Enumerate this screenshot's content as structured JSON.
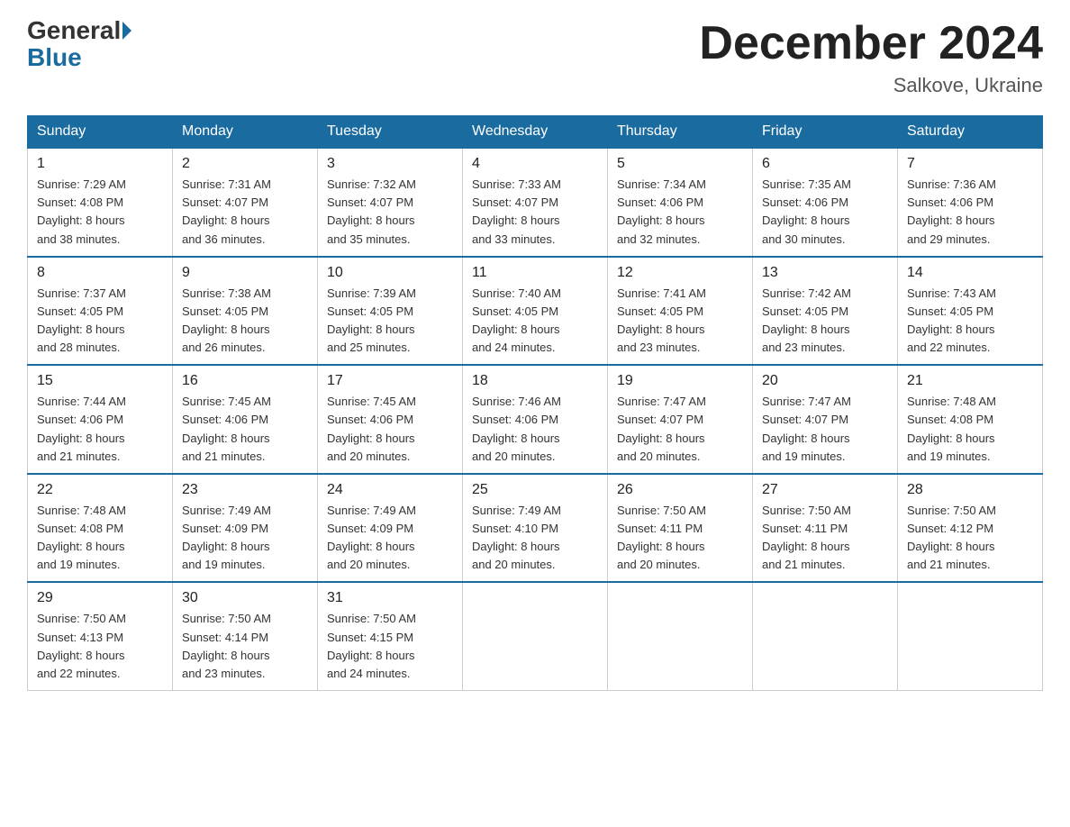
{
  "logo": {
    "general": "General",
    "blue": "Blue"
  },
  "title": "December 2024",
  "subtitle": "Salkove, Ukraine",
  "days_header": [
    "Sunday",
    "Monday",
    "Tuesday",
    "Wednesday",
    "Thursday",
    "Friday",
    "Saturday"
  ],
  "weeks": [
    [
      {
        "num": "1",
        "sunrise": "7:29 AM",
        "sunset": "4:08 PM",
        "daylight": "8 hours and 38 minutes."
      },
      {
        "num": "2",
        "sunrise": "7:31 AM",
        "sunset": "4:07 PM",
        "daylight": "8 hours and 36 minutes."
      },
      {
        "num": "3",
        "sunrise": "7:32 AM",
        "sunset": "4:07 PM",
        "daylight": "8 hours and 35 minutes."
      },
      {
        "num": "4",
        "sunrise": "7:33 AM",
        "sunset": "4:07 PM",
        "daylight": "8 hours and 33 minutes."
      },
      {
        "num": "5",
        "sunrise": "7:34 AM",
        "sunset": "4:06 PM",
        "daylight": "8 hours and 32 minutes."
      },
      {
        "num": "6",
        "sunrise": "7:35 AM",
        "sunset": "4:06 PM",
        "daylight": "8 hours and 30 minutes."
      },
      {
        "num": "7",
        "sunrise": "7:36 AM",
        "sunset": "4:06 PM",
        "daylight": "8 hours and 29 minutes."
      }
    ],
    [
      {
        "num": "8",
        "sunrise": "7:37 AM",
        "sunset": "4:05 PM",
        "daylight": "8 hours and 28 minutes."
      },
      {
        "num": "9",
        "sunrise": "7:38 AM",
        "sunset": "4:05 PM",
        "daylight": "8 hours and 26 minutes."
      },
      {
        "num": "10",
        "sunrise": "7:39 AM",
        "sunset": "4:05 PM",
        "daylight": "8 hours and 25 minutes."
      },
      {
        "num": "11",
        "sunrise": "7:40 AM",
        "sunset": "4:05 PM",
        "daylight": "8 hours and 24 minutes."
      },
      {
        "num": "12",
        "sunrise": "7:41 AM",
        "sunset": "4:05 PM",
        "daylight": "8 hours and 23 minutes."
      },
      {
        "num": "13",
        "sunrise": "7:42 AM",
        "sunset": "4:05 PM",
        "daylight": "8 hours and 23 minutes."
      },
      {
        "num": "14",
        "sunrise": "7:43 AM",
        "sunset": "4:05 PM",
        "daylight": "8 hours and 22 minutes."
      }
    ],
    [
      {
        "num": "15",
        "sunrise": "7:44 AM",
        "sunset": "4:06 PM",
        "daylight": "8 hours and 21 minutes."
      },
      {
        "num": "16",
        "sunrise": "7:45 AM",
        "sunset": "4:06 PM",
        "daylight": "8 hours and 21 minutes."
      },
      {
        "num": "17",
        "sunrise": "7:45 AM",
        "sunset": "4:06 PM",
        "daylight": "8 hours and 20 minutes."
      },
      {
        "num": "18",
        "sunrise": "7:46 AM",
        "sunset": "4:06 PM",
        "daylight": "8 hours and 20 minutes."
      },
      {
        "num": "19",
        "sunrise": "7:47 AM",
        "sunset": "4:07 PM",
        "daylight": "8 hours and 20 minutes."
      },
      {
        "num": "20",
        "sunrise": "7:47 AM",
        "sunset": "4:07 PM",
        "daylight": "8 hours and 19 minutes."
      },
      {
        "num": "21",
        "sunrise": "7:48 AM",
        "sunset": "4:08 PM",
        "daylight": "8 hours and 19 minutes."
      }
    ],
    [
      {
        "num": "22",
        "sunrise": "7:48 AM",
        "sunset": "4:08 PM",
        "daylight": "8 hours and 19 minutes."
      },
      {
        "num": "23",
        "sunrise": "7:49 AM",
        "sunset": "4:09 PM",
        "daylight": "8 hours and 19 minutes."
      },
      {
        "num": "24",
        "sunrise": "7:49 AM",
        "sunset": "4:09 PM",
        "daylight": "8 hours and 20 minutes."
      },
      {
        "num": "25",
        "sunrise": "7:49 AM",
        "sunset": "4:10 PM",
        "daylight": "8 hours and 20 minutes."
      },
      {
        "num": "26",
        "sunrise": "7:50 AM",
        "sunset": "4:11 PM",
        "daylight": "8 hours and 20 minutes."
      },
      {
        "num": "27",
        "sunrise": "7:50 AM",
        "sunset": "4:11 PM",
        "daylight": "8 hours and 21 minutes."
      },
      {
        "num": "28",
        "sunrise": "7:50 AM",
        "sunset": "4:12 PM",
        "daylight": "8 hours and 21 minutes."
      }
    ],
    [
      {
        "num": "29",
        "sunrise": "7:50 AM",
        "sunset": "4:13 PM",
        "daylight": "8 hours and 22 minutes."
      },
      {
        "num": "30",
        "sunrise": "7:50 AM",
        "sunset": "4:14 PM",
        "daylight": "8 hours and 23 minutes."
      },
      {
        "num": "31",
        "sunrise": "7:50 AM",
        "sunset": "4:15 PM",
        "daylight": "8 hours and 24 minutes."
      },
      null,
      null,
      null,
      null
    ]
  ],
  "labels": {
    "sunrise": "Sunrise:",
    "sunset": "Sunset:",
    "daylight": "Daylight:"
  }
}
